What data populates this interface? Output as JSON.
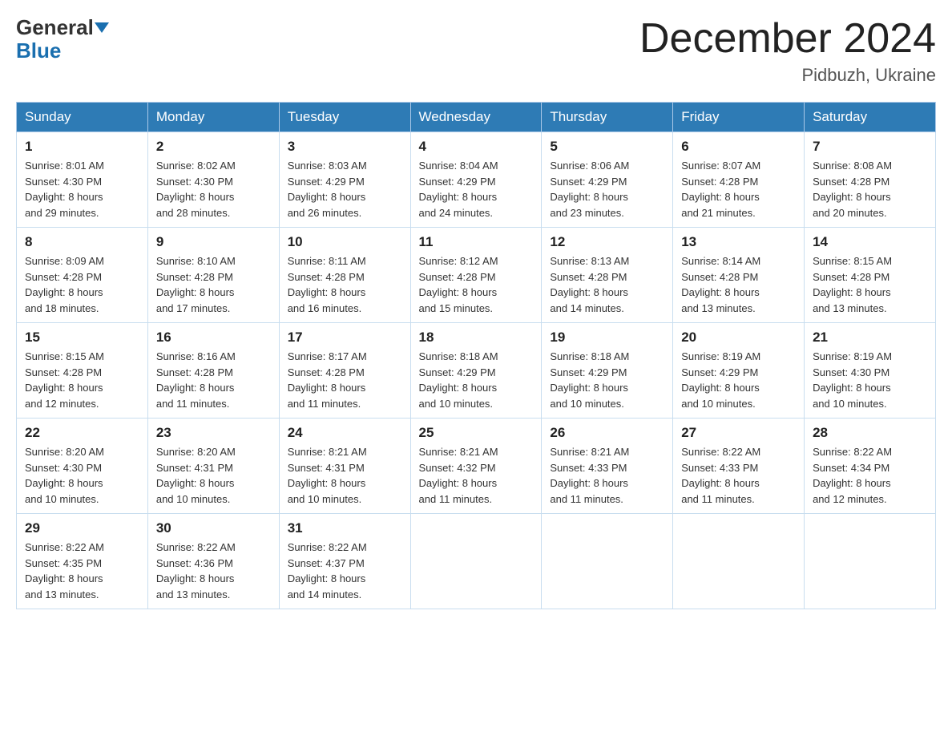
{
  "header": {
    "logo_line1": "General",
    "logo_line2": "Blue",
    "month_title": "December 2024",
    "location": "Pidbuzh, Ukraine"
  },
  "days_of_week": [
    "Sunday",
    "Monday",
    "Tuesday",
    "Wednesday",
    "Thursday",
    "Friday",
    "Saturday"
  ],
  "weeks": [
    [
      {
        "day": "1",
        "sunrise": "8:01 AM",
        "sunset": "4:30 PM",
        "daylight": "8 hours and 29 minutes."
      },
      {
        "day": "2",
        "sunrise": "8:02 AM",
        "sunset": "4:30 PM",
        "daylight": "8 hours and 28 minutes."
      },
      {
        "day": "3",
        "sunrise": "8:03 AM",
        "sunset": "4:29 PM",
        "daylight": "8 hours and 26 minutes."
      },
      {
        "day": "4",
        "sunrise": "8:04 AM",
        "sunset": "4:29 PM",
        "daylight": "8 hours and 24 minutes."
      },
      {
        "day": "5",
        "sunrise": "8:06 AM",
        "sunset": "4:29 PM",
        "daylight": "8 hours and 23 minutes."
      },
      {
        "day": "6",
        "sunrise": "8:07 AM",
        "sunset": "4:28 PM",
        "daylight": "8 hours and 21 minutes."
      },
      {
        "day": "7",
        "sunrise": "8:08 AM",
        "sunset": "4:28 PM",
        "daylight": "8 hours and 20 minutes."
      }
    ],
    [
      {
        "day": "8",
        "sunrise": "8:09 AM",
        "sunset": "4:28 PM",
        "daylight": "8 hours and 18 minutes."
      },
      {
        "day": "9",
        "sunrise": "8:10 AM",
        "sunset": "4:28 PM",
        "daylight": "8 hours and 17 minutes."
      },
      {
        "day": "10",
        "sunrise": "8:11 AM",
        "sunset": "4:28 PM",
        "daylight": "8 hours and 16 minutes."
      },
      {
        "day": "11",
        "sunrise": "8:12 AM",
        "sunset": "4:28 PM",
        "daylight": "8 hours and 15 minutes."
      },
      {
        "day": "12",
        "sunrise": "8:13 AM",
        "sunset": "4:28 PM",
        "daylight": "8 hours and 14 minutes."
      },
      {
        "day": "13",
        "sunrise": "8:14 AM",
        "sunset": "4:28 PM",
        "daylight": "8 hours and 13 minutes."
      },
      {
        "day": "14",
        "sunrise": "8:15 AM",
        "sunset": "4:28 PM",
        "daylight": "8 hours and 13 minutes."
      }
    ],
    [
      {
        "day": "15",
        "sunrise": "8:15 AM",
        "sunset": "4:28 PM",
        "daylight": "8 hours and 12 minutes."
      },
      {
        "day": "16",
        "sunrise": "8:16 AM",
        "sunset": "4:28 PM",
        "daylight": "8 hours and 11 minutes."
      },
      {
        "day": "17",
        "sunrise": "8:17 AM",
        "sunset": "4:28 PM",
        "daylight": "8 hours and 11 minutes."
      },
      {
        "day": "18",
        "sunrise": "8:18 AM",
        "sunset": "4:29 PM",
        "daylight": "8 hours and 10 minutes."
      },
      {
        "day": "19",
        "sunrise": "8:18 AM",
        "sunset": "4:29 PM",
        "daylight": "8 hours and 10 minutes."
      },
      {
        "day": "20",
        "sunrise": "8:19 AM",
        "sunset": "4:29 PM",
        "daylight": "8 hours and 10 minutes."
      },
      {
        "day": "21",
        "sunrise": "8:19 AM",
        "sunset": "4:30 PM",
        "daylight": "8 hours and 10 minutes."
      }
    ],
    [
      {
        "day": "22",
        "sunrise": "8:20 AM",
        "sunset": "4:30 PM",
        "daylight": "8 hours and 10 minutes."
      },
      {
        "day": "23",
        "sunrise": "8:20 AM",
        "sunset": "4:31 PM",
        "daylight": "8 hours and 10 minutes."
      },
      {
        "day": "24",
        "sunrise": "8:21 AM",
        "sunset": "4:31 PM",
        "daylight": "8 hours and 10 minutes."
      },
      {
        "day": "25",
        "sunrise": "8:21 AM",
        "sunset": "4:32 PM",
        "daylight": "8 hours and 11 minutes."
      },
      {
        "day": "26",
        "sunrise": "8:21 AM",
        "sunset": "4:33 PM",
        "daylight": "8 hours and 11 minutes."
      },
      {
        "day": "27",
        "sunrise": "8:22 AM",
        "sunset": "4:33 PM",
        "daylight": "8 hours and 11 minutes."
      },
      {
        "day": "28",
        "sunrise": "8:22 AM",
        "sunset": "4:34 PM",
        "daylight": "8 hours and 12 minutes."
      }
    ],
    [
      {
        "day": "29",
        "sunrise": "8:22 AM",
        "sunset": "4:35 PM",
        "daylight": "8 hours and 13 minutes."
      },
      {
        "day": "30",
        "sunrise": "8:22 AM",
        "sunset": "4:36 PM",
        "daylight": "8 hours and 13 minutes."
      },
      {
        "day": "31",
        "sunrise": "8:22 AM",
        "sunset": "4:37 PM",
        "daylight": "8 hours and 14 minutes."
      },
      null,
      null,
      null,
      null
    ]
  ],
  "labels": {
    "sunrise": "Sunrise:",
    "sunset": "Sunset:",
    "daylight": "Daylight:"
  }
}
